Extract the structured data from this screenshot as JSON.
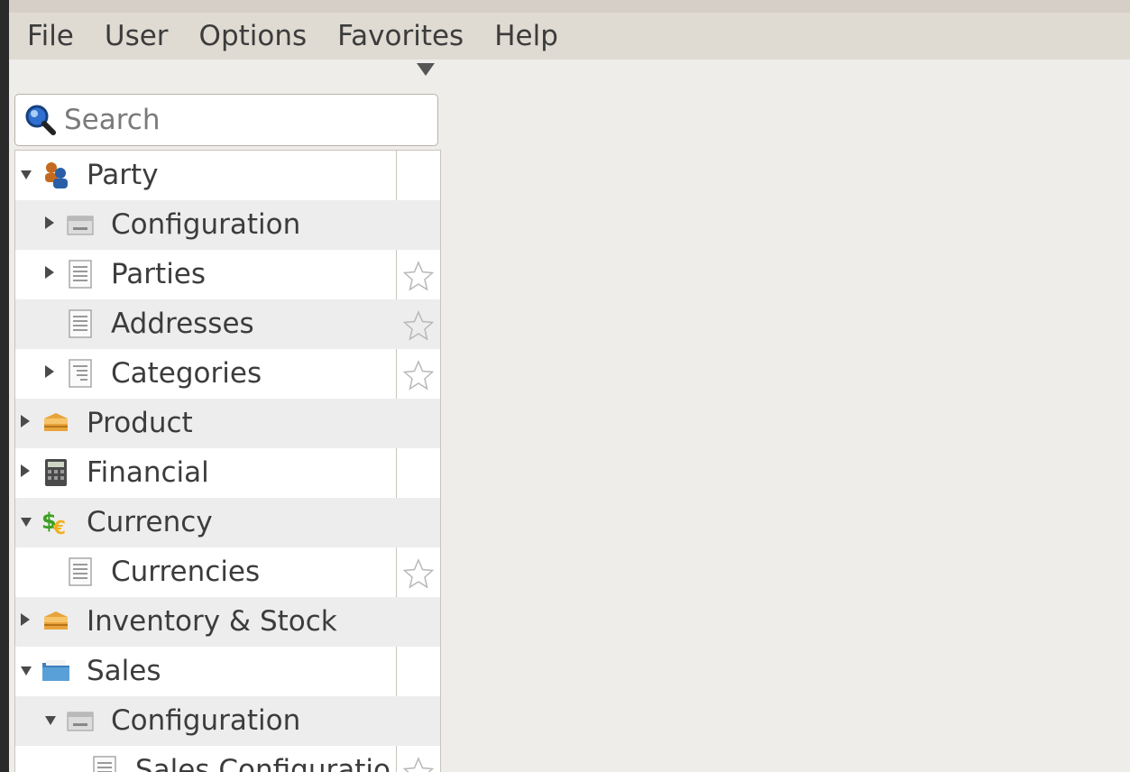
{
  "menubar": {
    "items": [
      "File",
      "User",
      "Options",
      "Favorites",
      "Help"
    ]
  },
  "search": {
    "placeholder": "Search"
  },
  "tree": {
    "rows": [
      {
        "label": "Party",
        "level": 0,
        "expander": "expanded",
        "icon": "party-icon",
        "favorite": false
      },
      {
        "label": "Configuration",
        "level": 1,
        "expander": "collapsed",
        "icon": "configuration-icon",
        "favorite": false
      },
      {
        "label": "Parties",
        "level": 1,
        "expander": "collapsed",
        "icon": "list-icon",
        "favorite": true
      },
      {
        "label": "Addresses",
        "level": 1,
        "expander": "none",
        "icon": "list-icon",
        "favorite": true
      },
      {
        "label": "Categories",
        "level": 1,
        "expander": "collapsed",
        "icon": "tree-list-icon",
        "favorite": true
      },
      {
        "label": "Product",
        "level": 0,
        "expander": "collapsed",
        "icon": "package-icon",
        "favorite": false
      },
      {
        "label": "Financial",
        "level": 0,
        "expander": "collapsed",
        "icon": "calculator-icon",
        "favorite": false
      },
      {
        "label": "Currency",
        "level": 0,
        "expander": "expanded",
        "icon": "currency-icon",
        "favorite": false
      },
      {
        "label": "Currencies",
        "level": 1,
        "expander": "none",
        "icon": "list-icon",
        "favorite": true
      },
      {
        "label": "Inventory & Stock",
        "level": 0,
        "expander": "collapsed",
        "icon": "package-icon",
        "favorite": false
      },
      {
        "label": "Sales",
        "level": 0,
        "expander": "expanded",
        "icon": "folder-icon",
        "favorite": false
      },
      {
        "label": "Configuration",
        "level": 1,
        "expander": "expanded",
        "icon": "configuration-icon",
        "favorite": false
      },
      {
        "label": "Sales Configuratio",
        "level": 2,
        "expander": "none",
        "icon": "list-icon",
        "favorite": true
      }
    ]
  },
  "colors": {
    "menubar_bg": "#dfdbd2",
    "row_alt_bg": "#ededed",
    "folder_blue": "#5aa0d8",
    "currency_green": "#3aa020",
    "currency_gold": "#f0b020"
  }
}
